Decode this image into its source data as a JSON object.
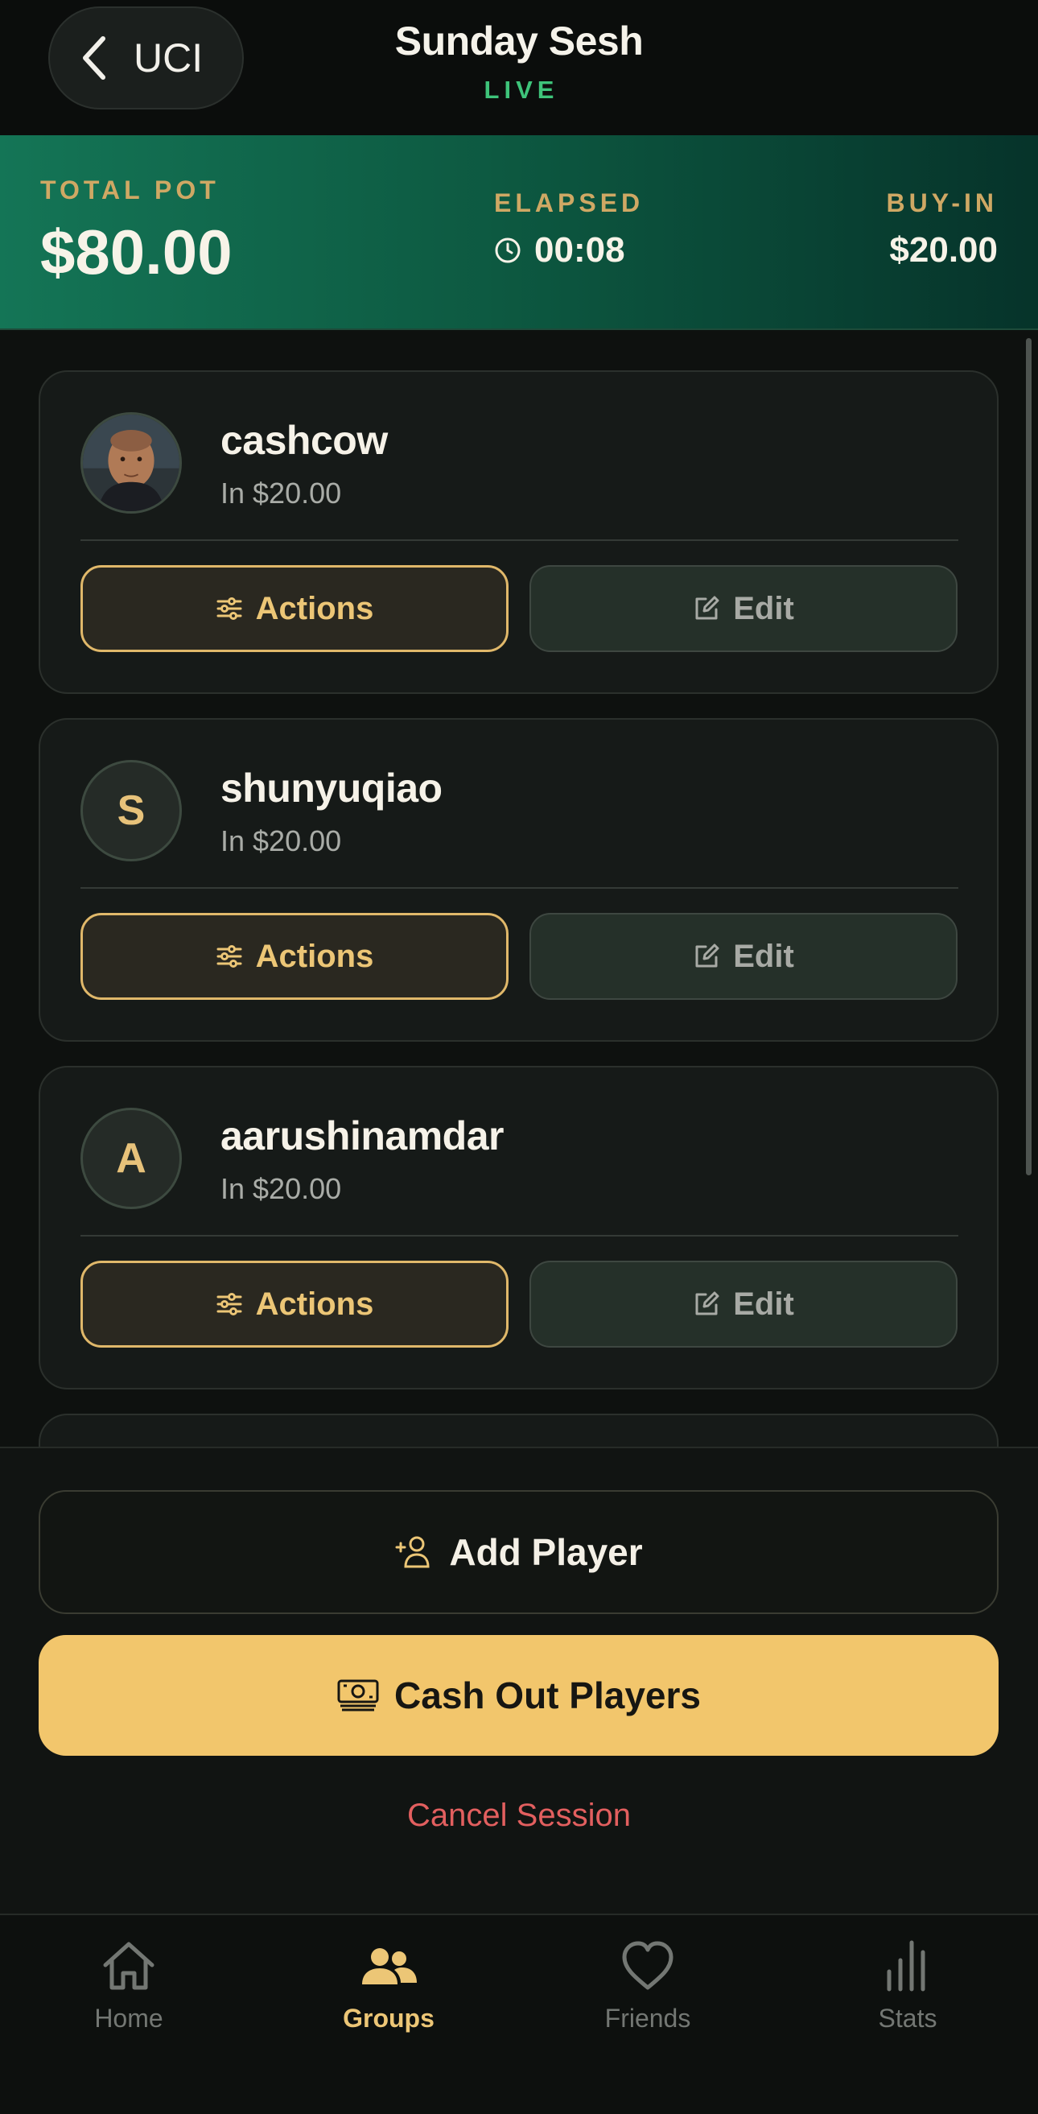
{
  "header": {
    "back_label": "UCI",
    "title": "Sunday Sesh",
    "status": "LIVE"
  },
  "summary": {
    "pot_label": "TOTAL POT",
    "pot_value": "$80.00",
    "elapsed_label": "ELAPSED",
    "elapsed_value": "00:08",
    "buyin_label": "BUY-IN",
    "buyin_value": "$20.00"
  },
  "players": [
    {
      "name": "cashcow",
      "in": "In $20.00",
      "avatar": "photo",
      "initial": "",
      "actions_label": "Actions",
      "edit_label": "Edit"
    },
    {
      "name": "shunyuqiao",
      "in": "In $20.00",
      "avatar": "initial",
      "initial": "S",
      "actions_label": "Actions",
      "edit_label": "Edit"
    },
    {
      "name": "aarushinamdar",
      "in": "In $20.00",
      "avatar": "initial",
      "initial": "A",
      "actions_label": "Actions",
      "edit_label": "Edit"
    }
  ],
  "footer": {
    "add_player": "Add Player",
    "cash_out": "Cash Out Players",
    "cancel": "Cancel Session"
  },
  "tabs": [
    {
      "label": "Home",
      "icon": "home-icon",
      "active": false
    },
    {
      "label": "Groups",
      "icon": "people-icon",
      "active": true
    },
    {
      "label": "Friends",
      "icon": "heart-icon",
      "active": false
    },
    {
      "label": "Stats",
      "icon": "bar-chart-icon",
      "active": false
    }
  ],
  "colors": {
    "accent": "#f2c66c",
    "live": "#3ec37a",
    "danger": "#e25f5f",
    "banner": "#147556"
  }
}
